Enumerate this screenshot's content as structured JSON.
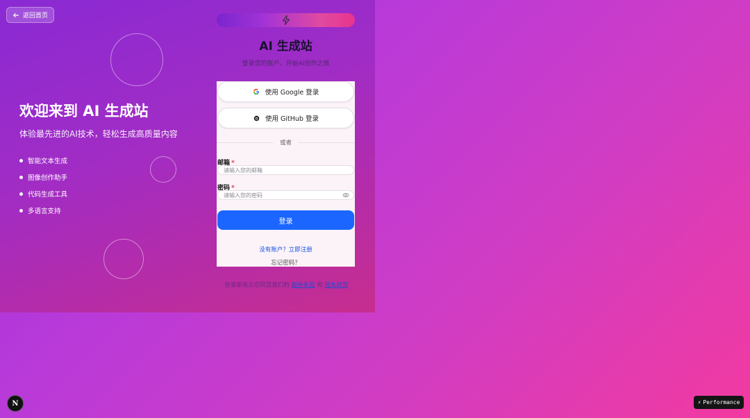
{
  "back": {
    "label": "返回首页"
  },
  "hero": {
    "title": "欢迎来到 AI 生成站",
    "subtitle": "体验最先进的AI技术，轻松生成高质量内容",
    "features": [
      "智能文本生成",
      "图像创作助手",
      "代码生成工具",
      "多语言支持"
    ]
  },
  "brand": {
    "title": "AI 生成站",
    "subtitle": "登录您的账户，开始AI创作之旅"
  },
  "auth": {
    "google_label": "使用 Google 登录",
    "github_label": "使用 GitHub 登录",
    "divider": "或者",
    "email_label": "邮箱",
    "email_placeholder": "请输入您的邮箱",
    "password_label": "密码",
    "password_placeholder": "请输入您的密码",
    "required_mark": "*",
    "login_label": "登录",
    "register_link": "没有账户？立即注册",
    "forgot_link": "忘记密码？"
  },
  "terms": {
    "prefix": "登录即表示您同意我们的",
    "service": "服务条款",
    "and": "和",
    "privacy": "隐私政策"
  },
  "dev": {
    "next_badge": "N",
    "performance_label": "Performance",
    "performance_icon": "⚡"
  },
  "colors": {
    "primary": "#1a66ff",
    "hero_start": "#8a2ad4",
    "hero_end": "#c72d8e",
    "page_end": "#f23aa0"
  }
}
